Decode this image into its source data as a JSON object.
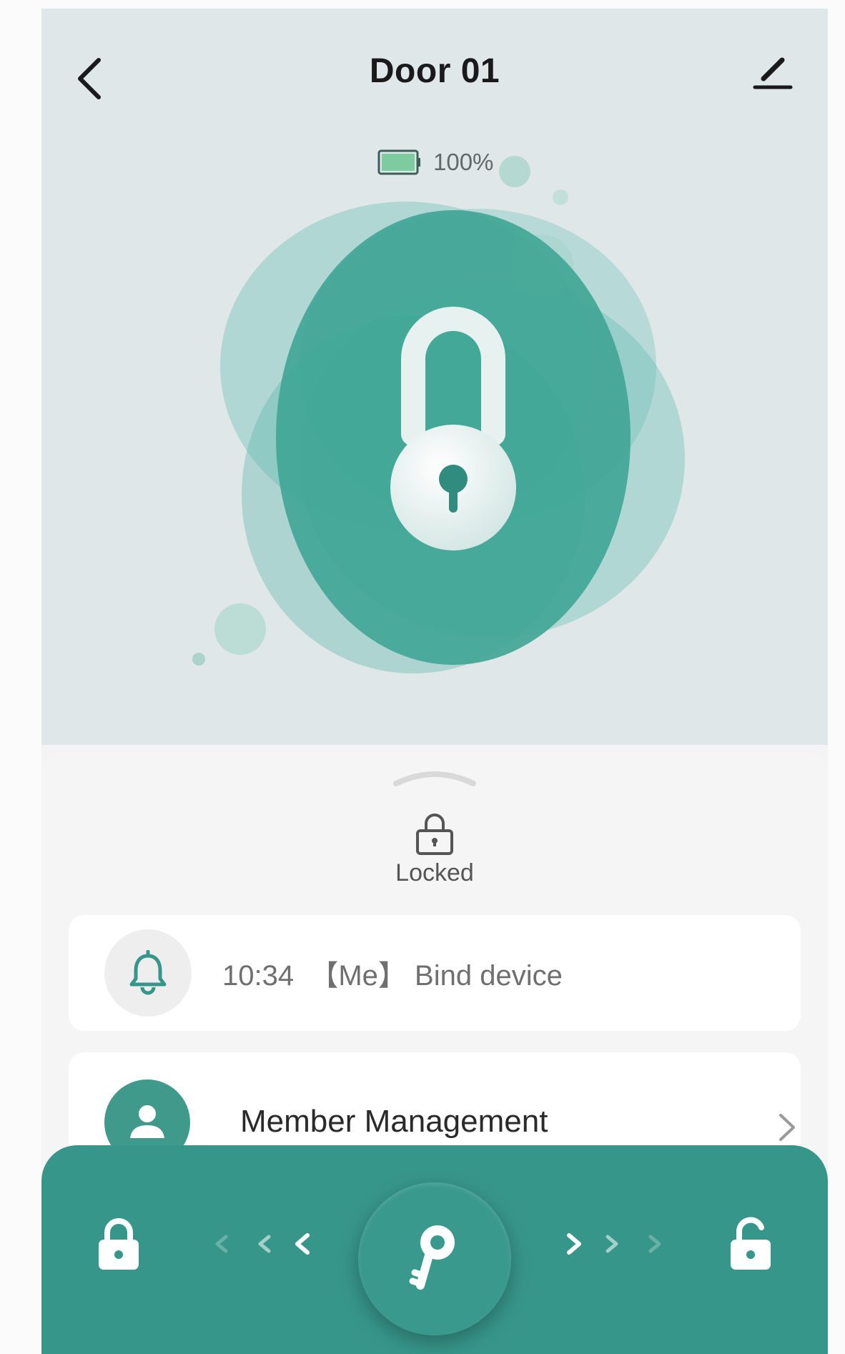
{
  "header": {
    "title": "Door 01",
    "back_icon": "chevron-left-icon",
    "edit_icon": "pencil-icon"
  },
  "battery": {
    "label": "100%",
    "level": 1.0,
    "fill_color": "#7ccca0"
  },
  "lock_status": {
    "state": "locked",
    "label": "Locked",
    "icon": "padlock-icon"
  },
  "latest_log": {
    "icon": "bell-icon",
    "time": "10:34",
    "actor": "【Me】",
    "action": "Bind device"
  },
  "menu": {
    "member_management": {
      "label": "Member Management",
      "icon": "user-icon"
    }
  },
  "action_bar": {
    "lock_icon": "lock-closed-icon",
    "key_icon": "key-icon",
    "unlock_icon": "lock-open-icon"
  },
  "colors": {
    "accent": "#37968a",
    "accent_light": "#5dbbae",
    "hero_bg": "#dfe7e8",
    "sheet_bg": "#f5f5f5"
  }
}
